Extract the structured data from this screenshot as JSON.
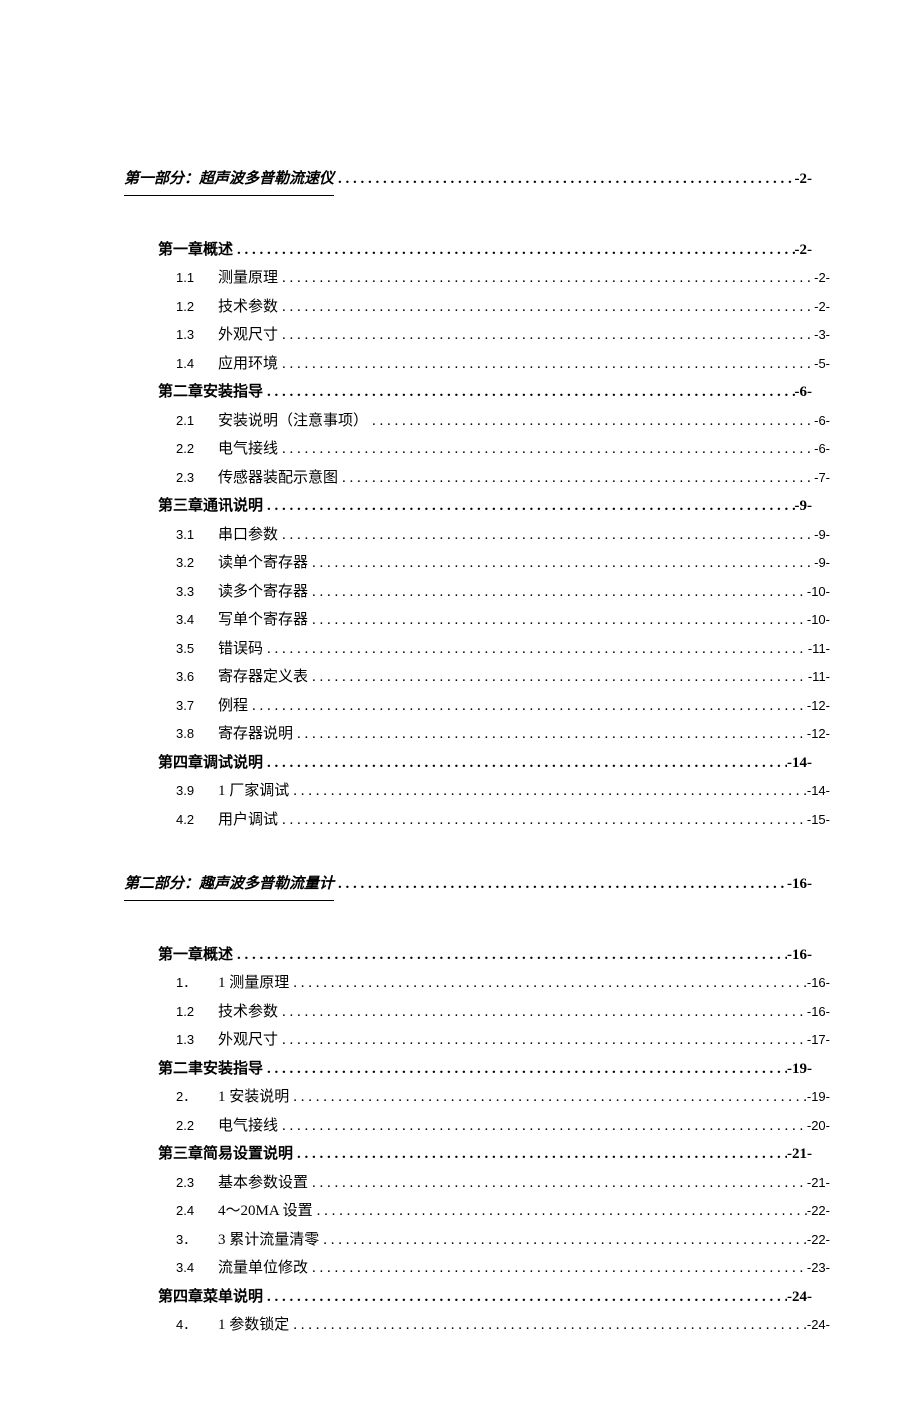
{
  "part1": {
    "title": "第一部分：超声波多普勒流速仪",
    "page": "-2-",
    "entries": [
      {
        "type": "chapter",
        "num": "",
        "label": "第一章概述",
        "page": "-2-"
      },
      {
        "type": "sub",
        "num": "1.1",
        "label": "测量原理",
        "page": "-2-"
      },
      {
        "type": "sub",
        "num": "1.2",
        "label": "技术参数",
        "page": "-2-"
      },
      {
        "type": "sub",
        "num": "1.3",
        "label": "外观尺寸",
        "page": "-3-"
      },
      {
        "type": "sub",
        "num": "1.4",
        "label": "应用环境",
        "page": "-5-"
      },
      {
        "type": "chapter",
        "num": "",
        "label": "第二章安装指导",
        "page": "-6-"
      },
      {
        "type": "sub",
        "num": "2.1",
        "label": "安装说明（注意事项）",
        "page": "-6-"
      },
      {
        "type": "sub",
        "num": "2.2",
        "label": "电气接线",
        "page": "-6-"
      },
      {
        "type": "sub",
        "num": "2.3",
        "label": "传感器装配示意图",
        "page": "-7-"
      },
      {
        "type": "chapter",
        "num": "",
        "label": "第三章通讯说明",
        "page": "-9-"
      },
      {
        "type": "sub",
        "num": "3.1",
        "label": "串口参数",
        "page": "-9-"
      },
      {
        "type": "sub",
        "num": "3.2",
        "label": "读单个寄存器",
        "page": "-9-"
      },
      {
        "type": "sub",
        "num": "3.3",
        "label": "读多个寄存器",
        "page": "-10-"
      },
      {
        "type": "sub",
        "num": "3.4",
        "label": "写单个寄存器",
        "page": "-10-"
      },
      {
        "type": "sub",
        "num": "3.5",
        "label": "错误码",
        "page": "-11-"
      },
      {
        "type": "sub",
        "num": "3.6",
        "label": "寄存器定义表",
        "page": "-11-"
      },
      {
        "type": "sub",
        "num": "3.7",
        "label": "例程",
        "page": "-12-"
      },
      {
        "type": "sub",
        "num": "3.8",
        "label": "寄存器说明",
        "page": "-12-"
      },
      {
        "type": "chapter",
        "num": "",
        "label": "第四章调试说明",
        "page": "-14-"
      },
      {
        "type": "sub",
        "num": "3.9",
        "label": "1 厂家调试",
        "page": "-14-"
      },
      {
        "type": "sub",
        "num": "4.2",
        "label": "用户调试",
        "page": "-15-"
      }
    ]
  },
  "part2": {
    "title": "第二部分：趣声波多普勒流量计",
    "page": "-16-",
    "entries": [
      {
        "type": "chapter",
        "num": "",
        "label": "第一章概述",
        "page": "-16-"
      },
      {
        "type": "sub",
        "num": "1．",
        "label": "1 测量原理",
        "page": "-16-"
      },
      {
        "type": "sub",
        "num": "1.2",
        "label": "技术参数",
        "page": "-16-"
      },
      {
        "type": "sub",
        "num": "1.3",
        "label": "外观尺寸",
        "page": "-17-"
      },
      {
        "type": "chapter",
        "num": "",
        "label": "第二聿安装指导",
        "page": "-19-"
      },
      {
        "type": "sub",
        "num": "2．",
        "label": "1 安装说明",
        "page": "-19-"
      },
      {
        "type": "sub",
        "num": "2.2",
        "label": "电气接线",
        "page": "-20-"
      },
      {
        "type": "chapter",
        "num": "",
        "label": "第三章简易设置说明",
        "page": "-21-"
      },
      {
        "type": "sub",
        "num": "2.3",
        "label": "基本参数设置",
        "page": "-21-"
      },
      {
        "type": "sub",
        "num": "2.4",
        "label": "4〜20MA 设置",
        "page": "-22-"
      },
      {
        "type": "sub",
        "num": "3．",
        "label": "3 累计流量清零",
        "page": "-22-"
      },
      {
        "type": "sub",
        "num": "3.4",
        "label": "流量单位修改",
        "page": "-23-"
      },
      {
        "type": "chapter",
        "num": "",
        "label": "第四章菜单说明",
        "page": "-24-"
      },
      {
        "type": "sub",
        "num": "4．",
        "label": "1 参数锁定",
        "page": "-24-"
      }
    ]
  }
}
